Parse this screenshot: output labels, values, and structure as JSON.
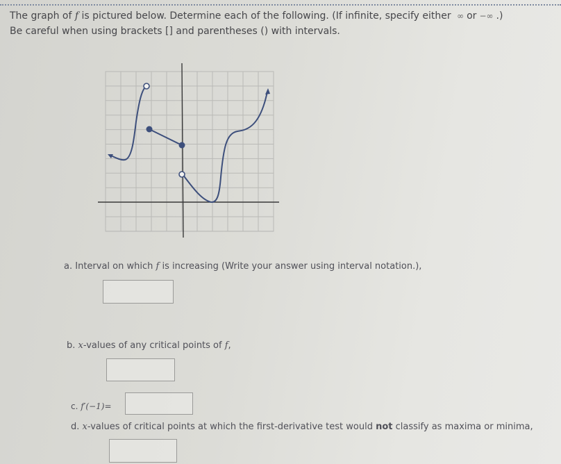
{
  "instructions": {
    "line1_prefix": "The graph of",
    "func": "f",
    "line1_suffix": "is pictured below. Determine each of the following. (If infinite, specify either",
    "inf_pos": "∞",
    "or": "or",
    "inf_neg": "−∞",
    "line1_end": ".)",
    "line2": "Be careful when using brackets [] and parentheses () with intervals."
  },
  "graph": {
    "description": "Graph of f with holes and jump discontinuity",
    "curve_color": "#3d4f7c",
    "grid_color": "#b9b9b6",
    "axis_color": "#3a3a3a",
    "x_range": [
      -5,
      6
    ],
    "y_range": [
      -2,
      9
    ],
    "open_points": [
      [
        -2,
        8
      ],
      [
        0,
        2
      ]
    ],
    "closed_points": [
      [
        -2,
        4
      ],
      [
        0,
        3
      ]
    ]
  },
  "questions": {
    "a": {
      "letter": "a.",
      "prefix": "Interval on which",
      "func": "f",
      "suffix": "is increasing (Write your answer using interval notation.),",
      "value": ""
    },
    "b": {
      "letter": "b.",
      "var": "x",
      "text": "-values of any critical points of",
      "func": "f",
      "end": ",",
      "value": ""
    },
    "c": {
      "letter": "c.",
      "expr": "f′(−1)=",
      "value": ""
    },
    "d": {
      "letter": "d.",
      "var": "x",
      "text_pre": "-values of critical points at which the first-derivative test would",
      "bold": "not",
      "text_post": "classify as maxima or minima,",
      "value": ""
    }
  }
}
